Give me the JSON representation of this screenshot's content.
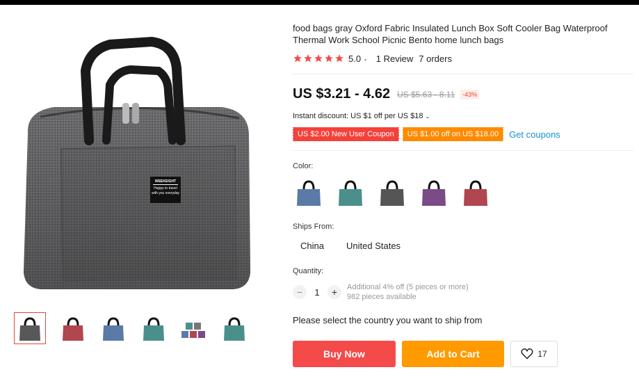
{
  "product": {
    "title": "food bags gray Oxford Fabric Insulated Lunch Box Soft Cooler Bag Waterproof Thermal Work School Picnic Bento home lunch bags",
    "rating": "5.0",
    "reviews": "1 Review",
    "orders": "7 orders",
    "price": "US $3.21 - 4.62",
    "old_price": "US $5.63 - 8.11",
    "discount": "-43%",
    "instant_discount": "Instant discount: US $1 off per US $18",
    "coupon_new_user": "US $2.00 New User Coupon",
    "coupon_off": "US $1.00 off on US $18.00",
    "get_coupons": "Get coupons",
    "brand_tag_line1": "WEEKEIGHT",
    "brand_tag_line2": "Happy to travel",
    "brand_tag_line3": "with you everyday"
  },
  "options": {
    "color_label": "Color:",
    "colors": [
      "#5a7aa8",
      "#4b8f8c",
      "#555555",
      "#7a4b86",
      "#b0464f"
    ],
    "thumbnail_colors": [
      "#58585a",
      "#b0464f",
      "#5a7aa8",
      "#4b8f8c",
      "#888888",
      "#4b8f8c"
    ],
    "ships_from_label": "Ships From:",
    "ships_from": [
      "China",
      "United States"
    ],
    "quantity_label": "Quantity:",
    "quantity": "1",
    "quantity_note": "Additional 4% off (5 pieces or more)",
    "available": "982 pieces available",
    "ship_message": "Please select the country you want to ship from"
  },
  "actions": {
    "buy_now": "Buy Now",
    "add_to_cart": "Add to Cart",
    "wishlist_count": "17"
  },
  "colors": {
    "accent_red": "#f44a4a",
    "accent_orange": "#ff9a00",
    "link_blue": "#1a8fd0",
    "star": "#f44a4a"
  }
}
